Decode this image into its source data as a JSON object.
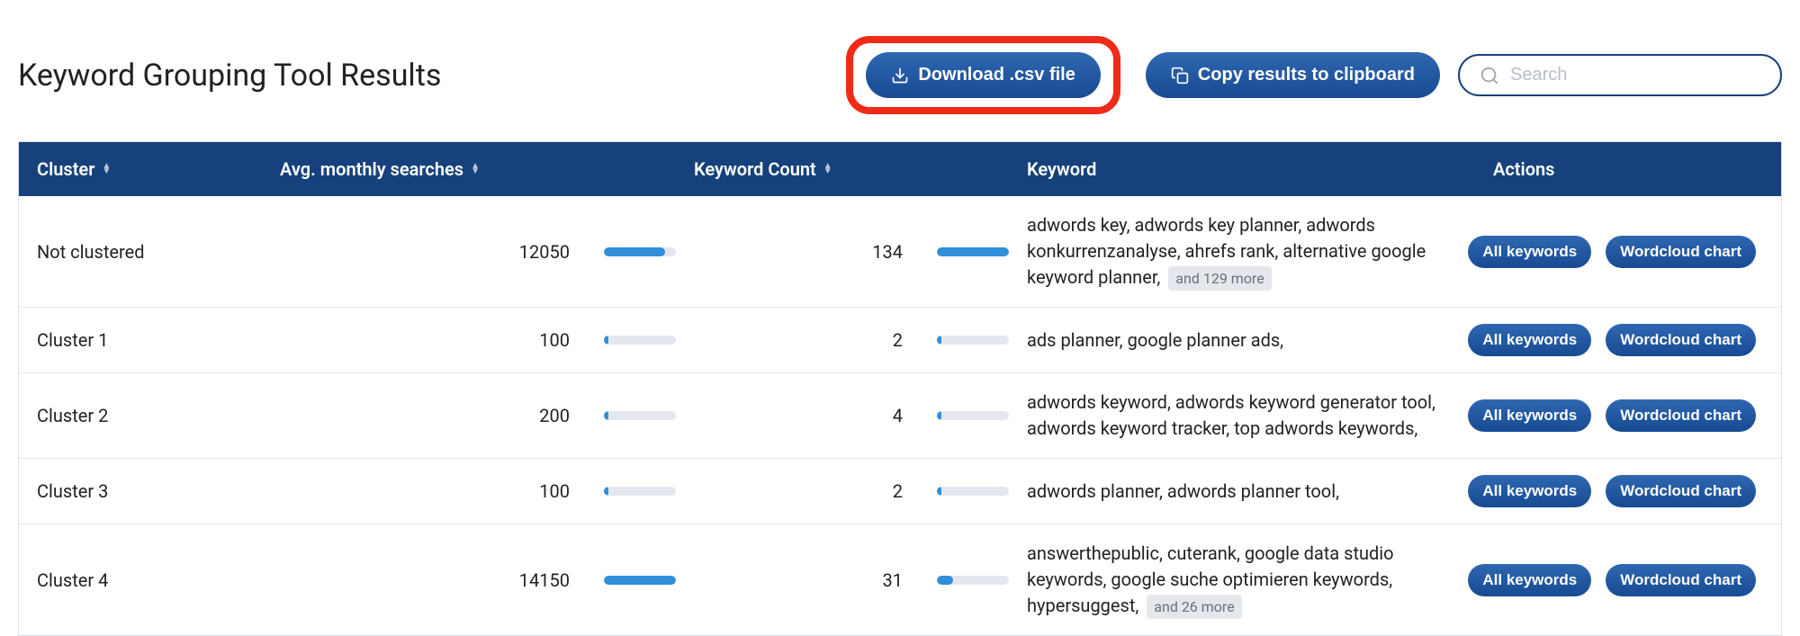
{
  "header": {
    "title": "Keyword Grouping Tool Results",
    "download_label": "Download .csv file",
    "copy_label": "Copy results to clipboard",
    "search_placeholder": "Search"
  },
  "table": {
    "columns": {
      "cluster": "Cluster",
      "searches": "Avg. monthly searches",
      "count": "Keyword Count",
      "keyword": "Keyword",
      "actions": "Actions"
    },
    "action_labels": {
      "all": "All keywords",
      "wordcloud": "Wordcloud chart"
    },
    "max_searches": 14150,
    "max_count": 134,
    "rows": [
      {
        "cluster": "Not clustered",
        "searches": 12050,
        "count": 134,
        "keywords": "adwords key, adwords key planner, adwords konkurrenzanalyse, ahrefs rank, alternative google keyword planner, ",
        "more": "and 129 more"
      },
      {
        "cluster": "Cluster 1",
        "searches": 100,
        "count": 2,
        "keywords": "ads planner, google planner ads,",
        "more": ""
      },
      {
        "cluster": "Cluster 2",
        "searches": 200,
        "count": 4,
        "keywords": "adwords keyword, adwords keyword generator tool, adwords keyword tracker, top adwords keywords,",
        "more": ""
      },
      {
        "cluster": "Cluster 3",
        "searches": 100,
        "count": 2,
        "keywords": "adwords planner, adwords planner tool,",
        "more": ""
      },
      {
        "cluster": "Cluster 4",
        "searches": 14150,
        "count": 31,
        "keywords": "answerthepublic, cuterank, google data studio keywords, google suche optimieren keywords, hypersuggest, ",
        "more": "and 26 more"
      }
    ]
  }
}
